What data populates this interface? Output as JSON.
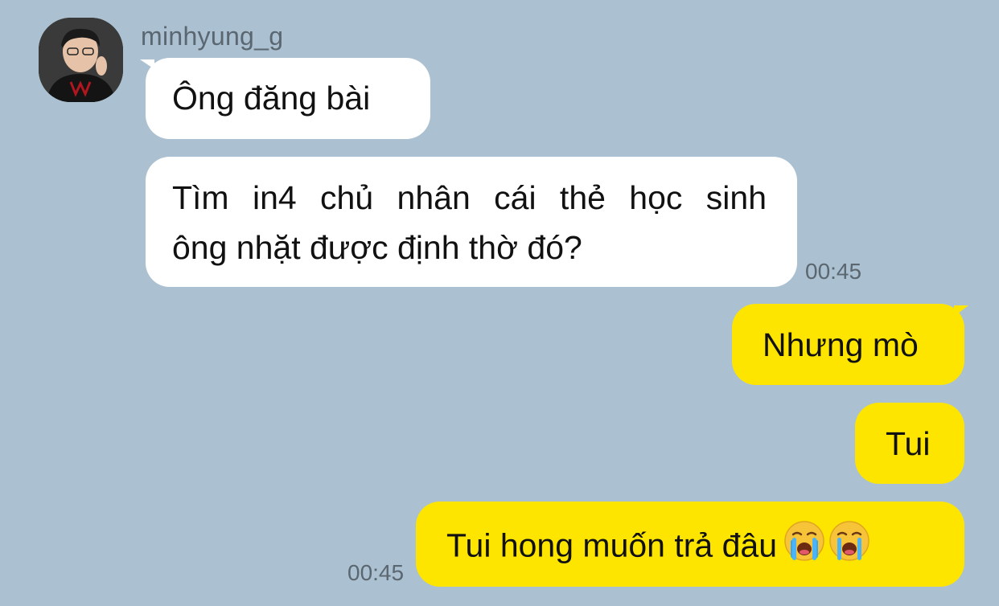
{
  "conversation": {
    "incoming": {
      "sender_name": "minhyung_g",
      "messages": [
        {
          "text": "Ông đăng bài"
        },
        {
          "text_line1": "Tìm in4 chủ nhân cái thẻ học sinh",
          "text_line2": "ông nhặt được định thờ đó?"
        }
      ],
      "time": "00:45"
    },
    "outgoing": {
      "messages": [
        {
          "text": "Nhưng mò"
        },
        {
          "text": "Tui"
        },
        {
          "text": "Tui hong muốn trả đâu",
          "emojis": [
            "crying-face",
            "crying-face"
          ]
        }
      ],
      "time": "00:45"
    }
  },
  "colors": {
    "background": "#abc1d1",
    "incoming_bubble": "#ffffff",
    "outgoing_bubble": "#fee500"
  }
}
